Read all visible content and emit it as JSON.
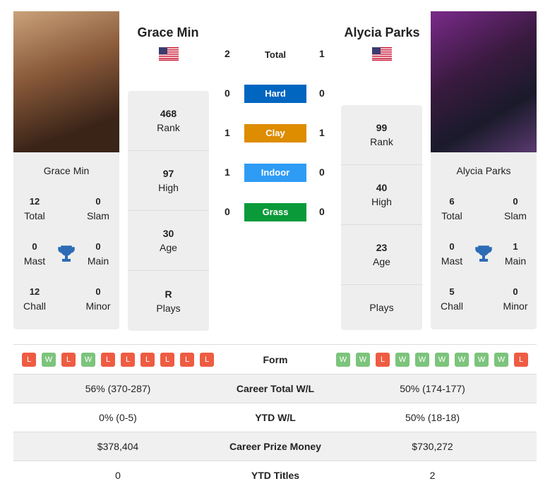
{
  "colors": {
    "win": "#7cc47c",
    "loss": "#ee5c42",
    "hard": "#0066c0",
    "clay": "#de8c00",
    "indoor": "#2e9cf5",
    "grass": "#0a9a3a"
  },
  "left": {
    "name": "Grace Min",
    "flag": "usa-flag",
    "total": "12",
    "total_label": "Total",
    "slam": "0",
    "slam_label": "Slam",
    "mast": "0",
    "mast_label": "Mast",
    "main": "0",
    "main_label": "Main",
    "chall": "12",
    "chall_label": "Chall",
    "minor": "0",
    "minor_label": "Minor",
    "rank": "468",
    "rank_label": "Rank",
    "high": "97",
    "high_label": "High",
    "age": "30",
    "age_label": "Age",
    "plays": "R",
    "plays_label": "Plays",
    "form": [
      "L",
      "W",
      "L",
      "W",
      "L",
      "L",
      "L",
      "L",
      "L",
      "L"
    ]
  },
  "right": {
    "name": "Alycia Parks",
    "flag": "usa-flag",
    "total": "6",
    "total_label": "Total",
    "slam": "0",
    "slam_label": "Slam",
    "mast": "0",
    "mast_label": "Mast",
    "main": "1",
    "main_label": "Main",
    "chall": "5",
    "chall_label": "Chall",
    "minor": "0",
    "minor_label": "Minor",
    "rank": "99",
    "rank_label": "Rank",
    "high": "40",
    "high_label": "High",
    "age": "23",
    "age_label": "Age",
    "plays": "",
    "plays_label": "Plays",
    "form": [
      "W",
      "W",
      "L",
      "W",
      "W",
      "W",
      "W",
      "W",
      "W",
      "L"
    ]
  },
  "h2h": {
    "total": {
      "label": "Total",
      "left": "2",
      "right": "1"
    },
    "surfaces": [
      {
        "label": "Hard",
        "left": "0",
        "right": "0"
      },
      {
        "label": "Clay",
        "left": "1",
        "right": "1"
      },
      {
        "label": "Indoor",
        "left": "1",
        "right": "0"
      },
      {
        "label": "Grass",
        "left": "0",
        "right": "0"
      }
    ]
  },
  "table": {
    "form_label": "Form",
    "rows": [
      {
        "label": "Career Total W/L",
        "left": "56% (370-287)",
        "right": "50% (174-177)"
      },
      {
        "label": "YTD W/L",
        "left": "0% (0-5)",
        "right": "50% (18-18)"
      },
      {
        "label": "Career Prize Money",
        "left": "$378,404",
        "right": "$730,272"
      },
      {
        "label": "YTD Titles",
        "left": "0",
        "right": "2"
      }
    ]
  }
}
